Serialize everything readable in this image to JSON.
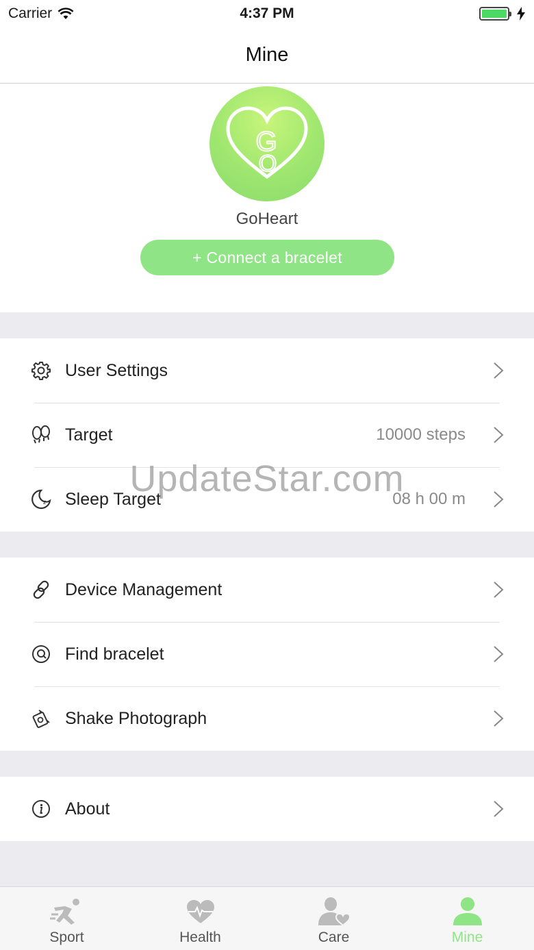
{
  "status_bar": {
    "carrier": "Carrier",
    "time": "4:37 PM"
  },
  "nav": {
    "title": "Mine"
  },
  "profile": {
    "name": "GoHeart",
    "connect_label": "+ Connect a bracelet"
  },
  "groups": [
    [
      {
        "icon": "gear-icon",
        "label": "User Settings",
        "value": ""
      },
      {
        "icon": "footprints-icon",
        "label": "Target",
        "value": "10000 steps"
      },
      {
        "icon": "moon-icon",
        "label": "Sleep Target",
        "value": "08 h 00 m"
      }
    ],
    [
      {
        "icon": "link-icon",
        "label": "Device Management",
        "value": ""
      },
      {
        "icon": "locate-icon",
        "label": "Find bracelet",
        "value": ""
      },
      {
        "icon": "shake-camera-icon",
        "label": "Shake Photograph",
        "value": ""
      }
    ],
    [
      {
        "icon": "info-icon",
        "label": "About",
        "value": ""
      }
    ]
  ],
  "tabs": [
    {
      "label": "Sport",
      "icon": "runner-icon",
      "active": false
    },
    {
      "label": "Health",
      "icon": "heart-pulse-icon",
      "active": false
    },
    {
      "label": "Care",
      "icon": "person-heart-icon",
      "active": false
    },
    {
      "label": "Mine",
      "icon": "person-icon",
      "active": true
    }
  ],
  "watermark": "UpdateStar.com",
  "colors": {
    "accent": "#8fe585",
    "separator": "#ebebf0"
  }
}
